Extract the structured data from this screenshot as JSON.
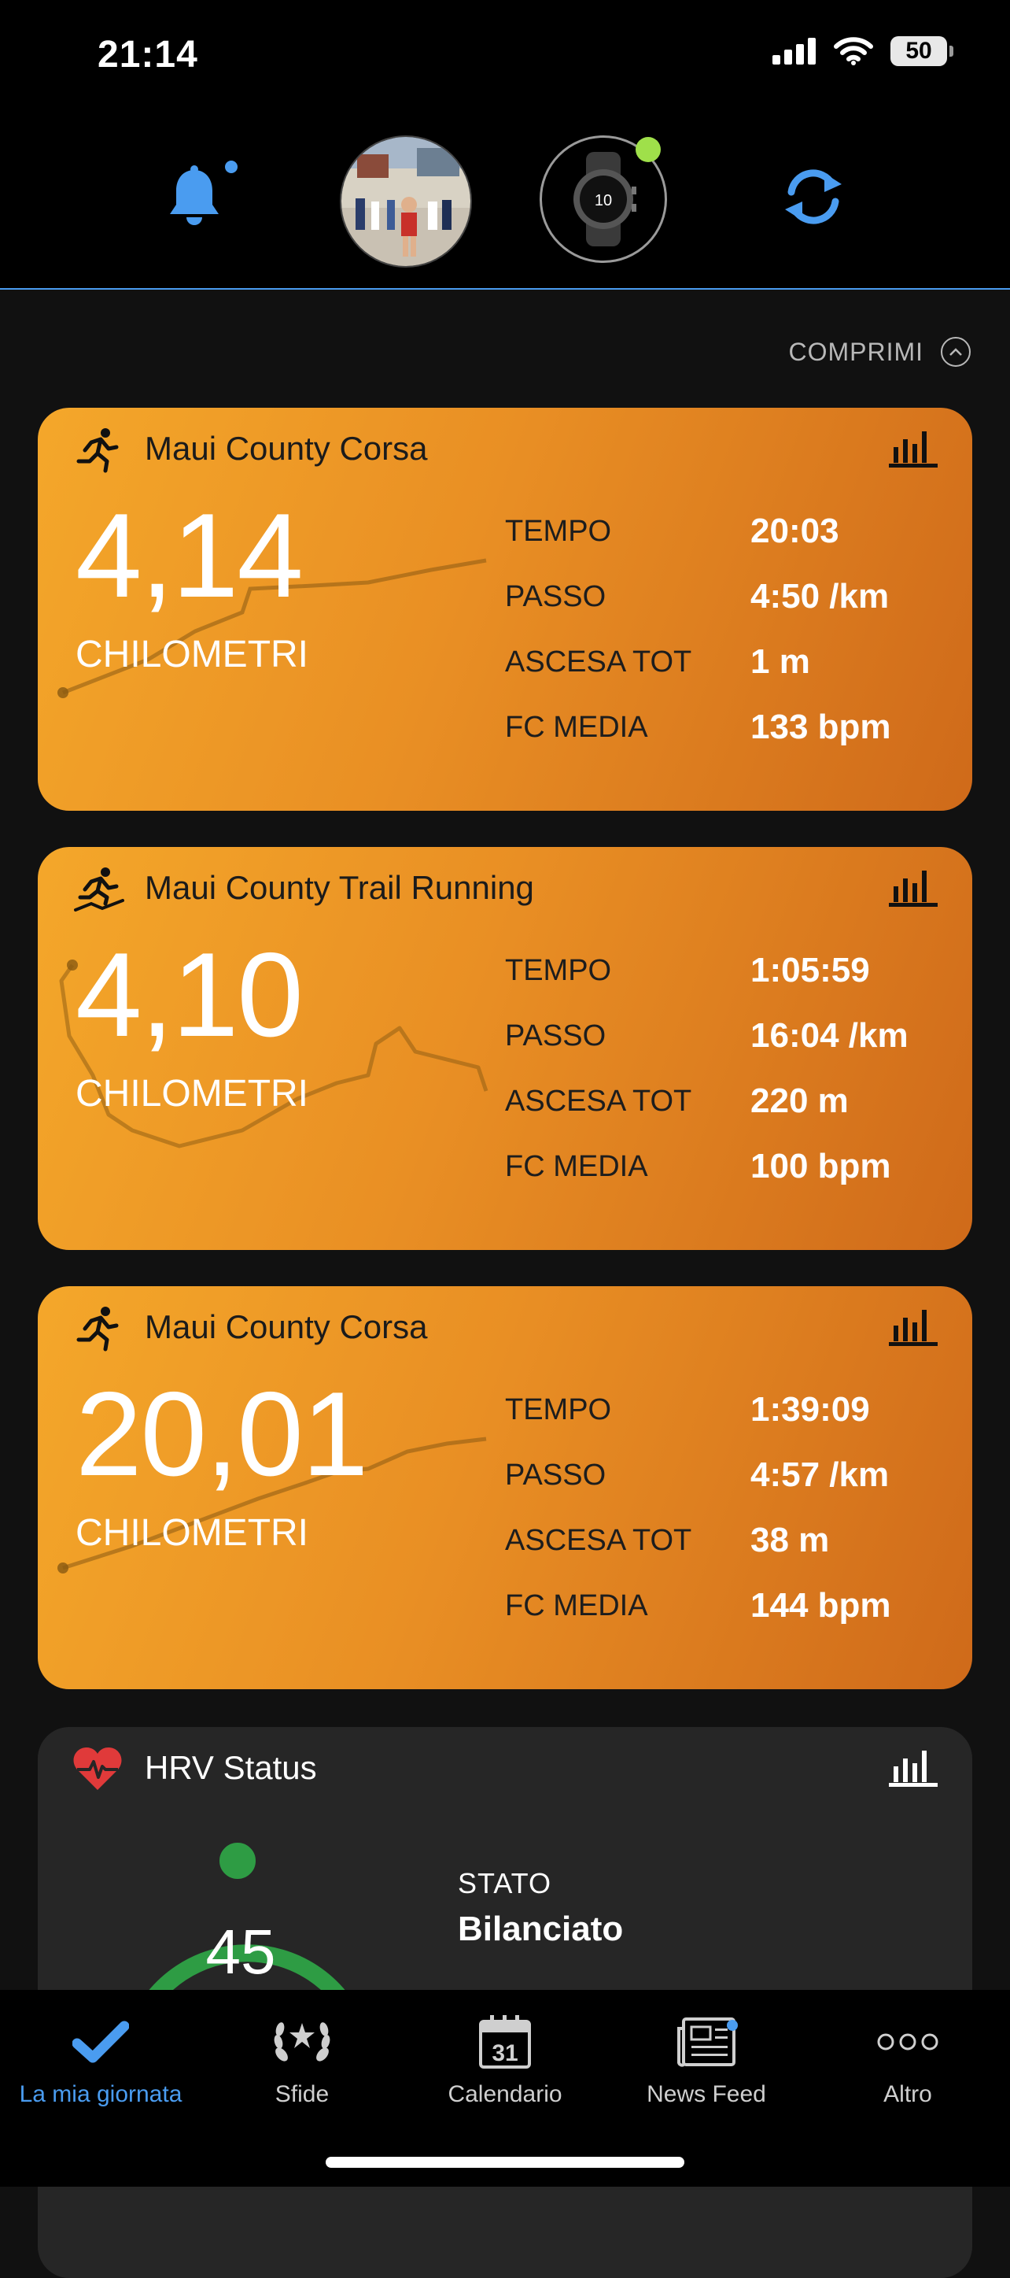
{
  "status_bar": {
    "time": "21:14",
    "battery": "50"
  },
  "header": {
    "icons": [
      "bell-icon",
      "avatar",
      "watch-icon",
      "sync-icon"
    ]
  },
  "collapse_label": "COMPRIMI",
  "activities": [
    {
      "icon": "running-icon",
      "title": "Maui County Corsa",
      "distance": "4,14",
      "unit": "CHILOMETRI",
      "stats": [
        {
          "label": "TEMPO",
          "value": "20:03"
        },
        {
          "label": "PASSO",
          "value": "4:50 /km"
        },
        {
          "label": "ASCESA TOT",
          "value": "1 m"
        },
        {
          "label": "FC MEDIA",
          "value": "133 bpm"
        }
      ]
    },
    {
      "icon": "trail-running-icon",
      "title": "Maui County Trail Running",
      "distance": "4,10",
      "unit": "CHILOMETRI",
      "stats": [
        {
          "label": "TEMPO",
          "value": "1:05:59"
        },
        {
          "label": "PASSO",
          "value": "16:04 /km"
        },
        {
          "label": "ASCESA TOT",
          "value": "220 m"
        },
        {
          "label": "FC MEDIA",
          "value": "100 bpm"
        }
      ]
    },
    {
      "icon": "running-icon",
      "title": "Maui County Corsa",
      "distance": "20,01",
      "unit": "CHILOMETRI",
      "stats": [
        {
          "label": "TEMPO",
          "value": "1:39:09"
        },
        {
          "label": "PASSO",
          "value": "4:57 /km"
        },
        {
          "label": "ASCESA TOT",
          "value": "38 m"
        },
        {
          "label": "FC MEDIA",
          "value": "144 bpm"
        }
      ]
    }
  ],
  "hrv": {
    "title": "HRV Status",
    "value": "45",
    "status_label": "STATO",
    "status_value": "Bilanciato"
  },
  "tabs": [
    {
      "label": "La mia giornata",
      "icon": "checkmark-icon",
      "active": true
    },
    {
      "label": "Sfide",
      "icon": "laurel-icon",
      "active": false
    },
    {
      "label": "Calendario",
      "icon": "calendar-icon",
      "active": false,
      "icon_text": "31"
    },
    {
      "label": "News Feed",
      "icon": "newspaper-icon",
      "active": false
    },
    {
      "label": "Altro",
      "icon": "more-icon",
      "active": false
    }
  ],
  "colors": {
    "accent": "#4a9cf0",
    "card_orange": "#ef9a26",
    "hrv_green": "#2e9c44",
    "hrv_orange": "#e2702a",
    "device_online": "#9fe04a"
  }
}
